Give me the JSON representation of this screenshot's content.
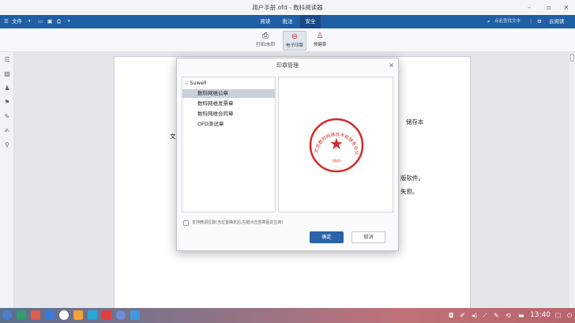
{
  "window": {
    "title": "用户手册.ofd - 数科阅读器",
    "minimize": "–",
    "maximize": "▫",
    "close": "✕"
  },
  "menubar": {
    "file": "文件",
    "tabs": [
      {
        "label": "阅读"
      },
      {
        "label": "批注"
      },
      {
        "label": "安全"
      }
    ],
    "search_placeholder": "点此查找文本",
    "login": "云阅读"
  },
  "ribbon": {
    "print_watermark": "打印/水印",
    "electronic_seal": "电子印章",
    "handwritten_seal": "领健章"
  },
  "document": {
    "line1_right": "储存本",
    "line1_left": "文",
    "line2": "版软件。",
    "line3": "失担。"
  },
  "dialog": {
    "title": "印章管理",
    "close": "×",
    "tree_root": "Suwell",
    "seals": [
      {
        "label": "数科网维公章"
      },
      {
        "label": "数科网维发票章"
      },
      {
        "label": "数科网维合同章"
      },
      {
        "label": "OFD测试章"
      }
    ],
    "selected_index": 0,
    "seal_preview_text": "北京数科网维技术有限责任公司",
    "seal_code": "(测试)",
    "seal_color": "#d42a2a",
    "checkbox_label": "支持微调位置(当位置确定后,右键点击签章固定生效)",
    "ok": "确定",
    "cancel": "取消"
  },
  "taskbar": {
    "time": "13:40"
  }
}
